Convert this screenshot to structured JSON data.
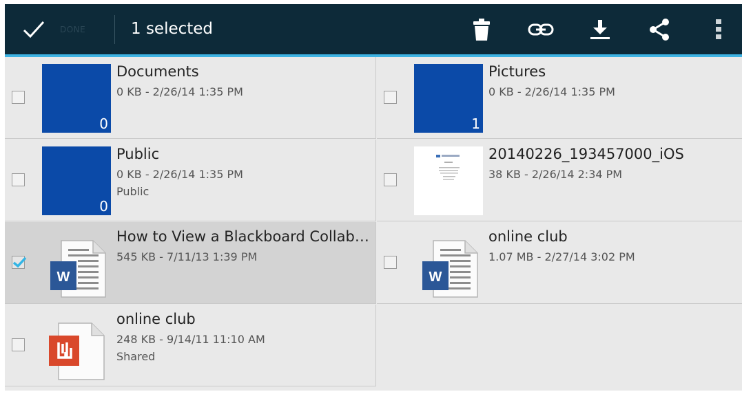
{
  "action_bar": {
    "done_label": "DONE",
    "selection_count": "1 selected",
    "actions": [
      {
        "name": "delete",
        "icon": "trash-icon"
      },
      {
        "name": "get-link",
        "icon": "link-icon"
      },
      {
        "name": "download",
        "icon": "download-icon"
      },
      {
        "name": "share",
        "icon": "share-icon"
      },
      {
        "name": "overflow",
        "icon": "more-vert-icon"
      }
    ]
  },
  "colors": {
    "action_bar": "#0d2a39",
    "accent_line": "#3eb3e3",
    "folder": "#0b4aa8",
    "word_blue": "#2b5797",
    "pdf_red": "#d9482b",
    "check_blue": "#33b5e5"
  },
  "items": [
    {
      "name": "Documents",
      "meta": "0 KB - 2/26/14 1:35 PM",
      "sub": "",
      "type": "folder",
      "count": "0",
      "selected": false
    },
    {
      "name": "Pictures",
      "meta": "0 KB - 2/26/14 1:35 PM",
      "sub": "",
      "type": "folder",
      "count": "1",
      "selected": false
    },
    {
      "name": "Public",
      "meta": "0 KB - 2/26/14 1:35 PM",
      "sub": "Public",
      "type": "folder",
      "count": "0",
      "selected": false
    },
    {
      "name": "20140226_193457000_iOS",
      "meta": "38 KB - 2/26/14 2:34 PM",
      "sub": "",
      "type": "image",
      "selected": false
    },
    {
      "name": "How to View a Blackboard Collaborate Recording",
      "meta": "545 KB - 7/11/13 1:39 PM",
      "sub": "",
      "type": "word",
      "selected": true
    },
    {
      "name": "online club",
      "meta": "1.07 MB - 2/27/14 3:02 PM",
      "sub": "",
      "type": "word",
      "selected": false
    },
    {
      "name": "online club",
      "meta": "248 KB - 9/14/11 11:10 AM",
      "sub": "Shared",
      "type": "pdf",
      "selected": false
    }
  ]
}
